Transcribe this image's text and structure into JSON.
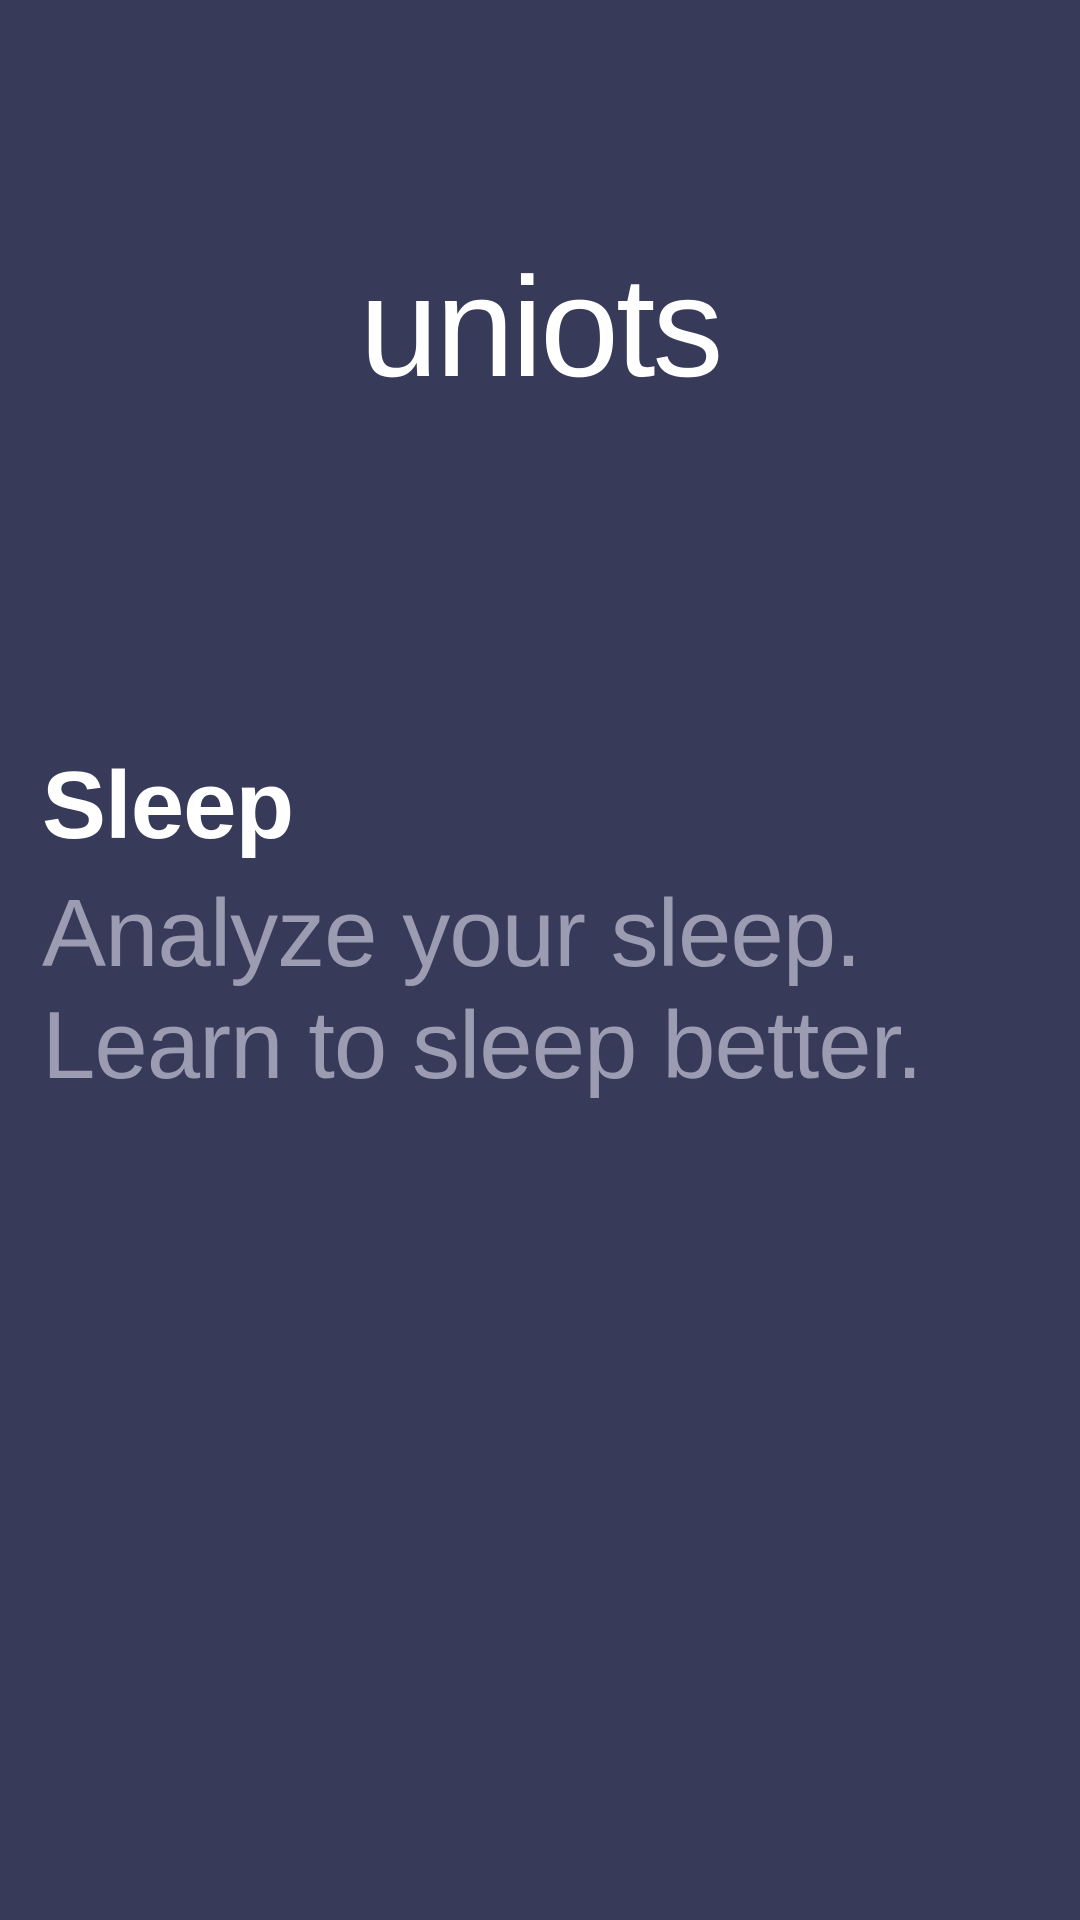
{
  "app": {
    "brand": "uniots"
  },
  "feature": {
    "title": "Sleep",
    "description_lines": [
      "Analyze your sleep.",
      "Learn to sleep better."
    ]
  },
  "colors": {
    "background": "#383a59",
    "title_text": "#ffffff",
    "description_text": "#9b9cb1"
  }
}
